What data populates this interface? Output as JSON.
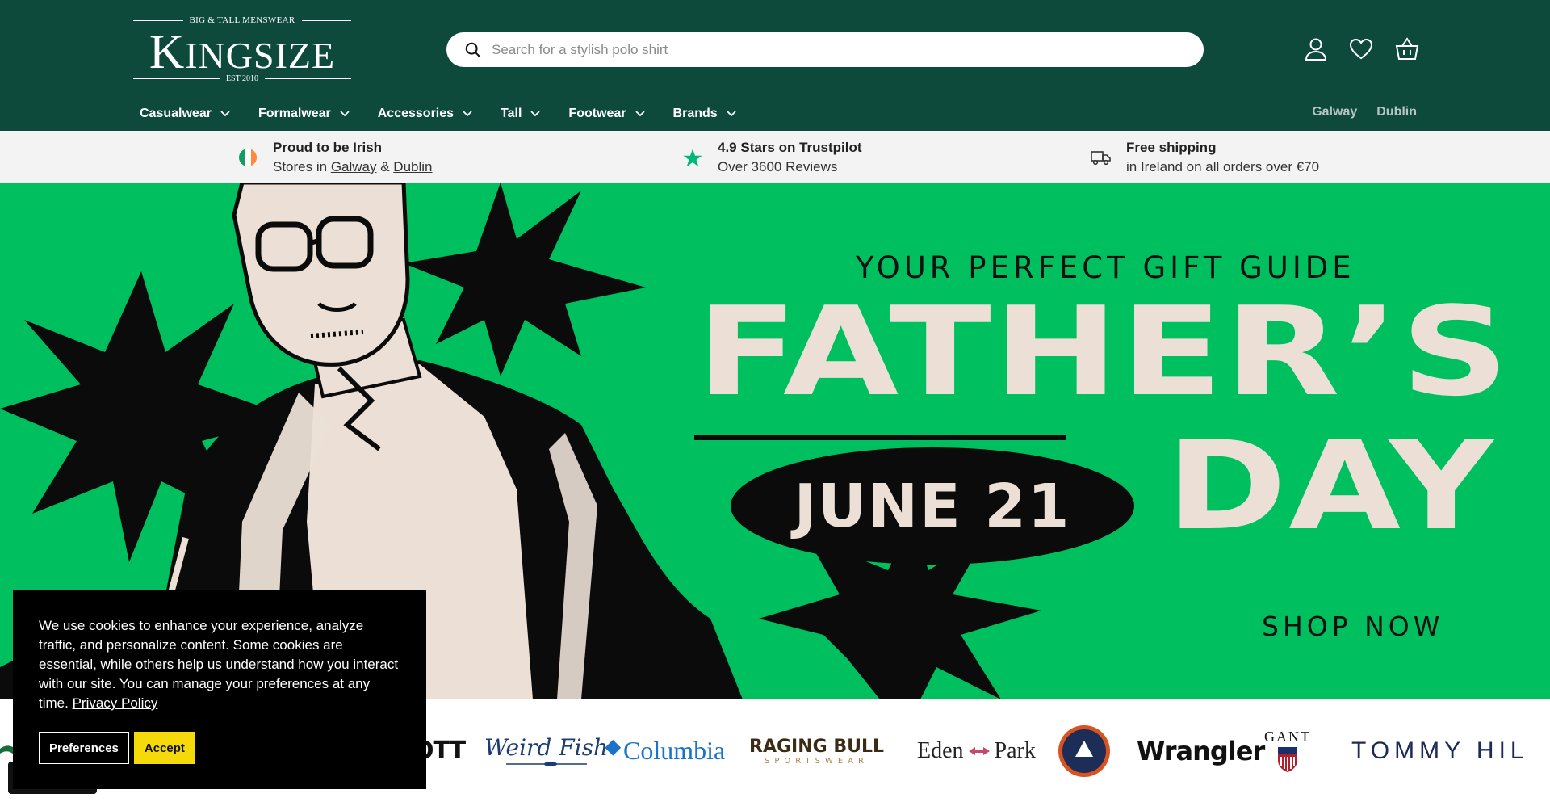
{
  "header": {
    "logo": {
      "tagline_top": "BIG & TALL MENSWEAR",
      "name_first": "K",
      "name_rest": "INGSIZE",
      "tagline_bottom": "EST 2010"
    },
    "search": {
      "placeholder": "Search for a stylish polo shirt",
      "value": ""
    },
    "icons": [
      "account-icon",
      "wishlist-icon",
      "basket-icon"
    ],
    "nav": [
      {
        "label": "Casualwear"
      },
      {
        "label": "Formalwear"
      },
      {
        "label": "Accessories"
      },
      {
        "label": "Tall"
      },
      {
        "label": "Footwear"
      },
      {
        "label": "Brands"
      }
    ],
    "stores": [
      "Galway",
      "Dublin"
    ]
  },
  "infobar": {
    "irish": {
      "title": "Proud to be Irish",
      "prefix": "Stores in ",
      "link1": "Galway",
      "amp": " & ",
      "link2": "Dublin"
    },
    "trustpilot": {
      "title": "4.9 Stars on Trustpilot",
      "subtitle": "Over 3600 Reviews"
    },
    "shipping": {
      "title": "Free shipping",
      "subtitle": "in Ireland on all orders over €70"
    }
  },
  "hero": {
    "kicker": "YOUR PERFECT GIFT GUIDE",
    "headline1": "FATHER’S",
    "headline2": "DAY",
    "date": "JUNE 21",
    "cta": "SHOP NOW"
  },
  "brands": {
    "items": [
      "OTT",
      "Weird Fish",
      "Columbia",
      "RAGING BULL",
      "SPORTSWEAR",
      "Eden",
      "Park",
      "Wrangler",
      "GANT",
      "TOMMY HIL"
    ]
  },
  "cookie": {
    "text": "We use cookies to enhance your experience, analyze traffic, and personalize content. Some cookies are essential, while others help us understand how you interact with our site. You can manage your preferences at any time. ",
    "link": "Privacy Policy",
    "preferences": "Preferences",
    "accept": "Accept"
  },
  "colors": {
    "header_bg": "#0d4a3c",
    "hero_bg": "#00bf5f",
    "accent_yellow": "#f5d90a",
    "cream": "#ece0d6"
  }
}
